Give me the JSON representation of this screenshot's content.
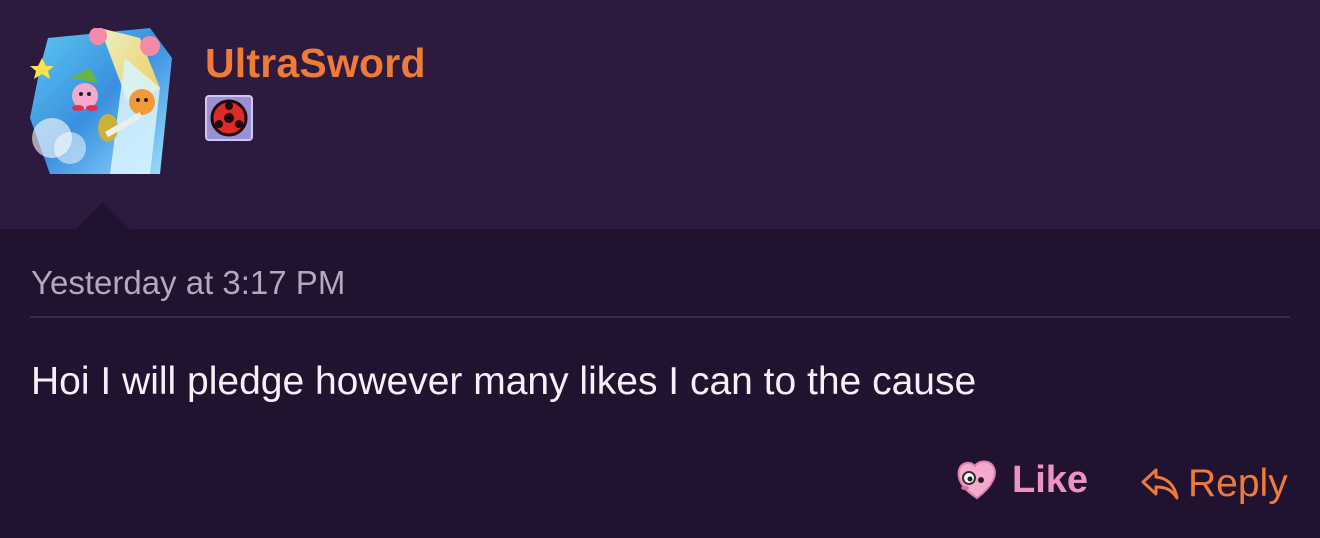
{
  "user": {
    "name": "UltraSword",
    "avatar_icon": "kirby-artwork-avatar",
    "badge_icon": "red-sharingan-badge-icon"
  },
  "post": {
    "timestamp": "Yesterday at 3:17 PM",
    "message": "Hoi I will pledge however many likes I can to the cause"
  },
  "actions": {
    "like_label": "Like",
    "like_icon": "kirby-heart-icon",
    "reply_label": "Reply",
    "reply_icon": "reply-arrow-icon"
  },
  "colors": {
    "header_bg": "#2c1a3f",
    "post_bg": "#21132f",
    "username": "#f07a38",
    "like": "#ed93c4",
    "reply": "#f07a38"
  }
}
